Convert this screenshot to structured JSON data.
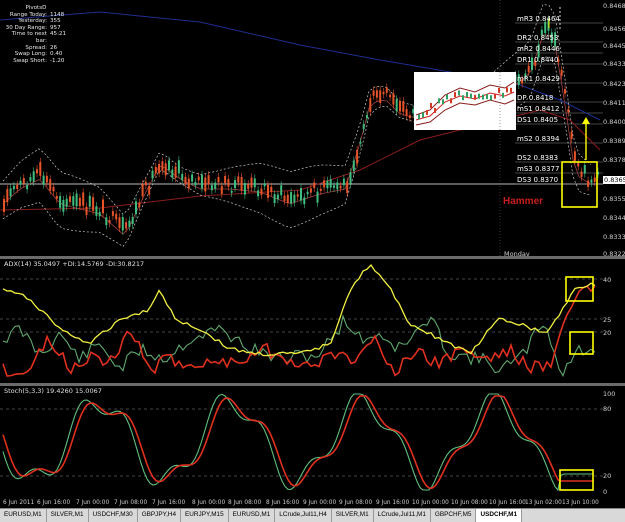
{
  "info_panel": {
    "title": "PivotsD",
    "rows": [
      {
        "label": "Range  Today:",
        "value": "1148"
      },
      {
        "label": "Yesterday:",
        "value": "355"
      },
      {
        "label": "30 Day Range:",
        "value": "957"
      },
      {
        "label": "Time to next bar:",
        "value": "45:21"
      },
      {
        "label": "Spread:",
        "value": "26"
      },
      {
        "label": "Swap  Long:",
        "value": "0.40"
      },
      {
        "label": "Swap  Short:",
        "value": "-1.20"
      }
    ]
  },
  "pivots": [
    {
      "label": "mR3",
      "value": "0.8464"
    },
    {
      "label": "DR2",
      "value": "0.8453"
    },
    {
      "label": "mR2",
      "value": "0.8446"
    },
    {
      "label": "DR1",
      "value": "0.8440"
    },
    {
      "label": "mR1",
      "value": "0.8429"
    },
    {
      "label": "DP",
      "value": "0.8418"
    },
    {
      "label": "mS1",
      "value": "0.8412"
    },
    {
      "label": "DS1",
      "value": "0.8405"
    },
    {
      "label": "mS2",
      "value": "0.8394"
    },
    {
      "label": "DS2",
      "value": "0.8383"
    },
    {
      "label": "mS3",
      "value": "0.8377"
    },
    {
      "label": "DS3",
      "value": "0.8370"
    }
  ],
  "price_axis": [
    "0.84680",
    "0.84565",
    "0.84450",
    "0.84335",
    "0.84230",
    "0.84115",
    "0.84000",
    "0.83895",
    "0.83780",
    "0.83665",
    "0.83550",
    "0.83445",
    "0.83335",
    "0.83225"
  ],
  "current_price": "0.83658",
  "annotations": {
    "hammer": "Hammer",
    "monday": "Monday"
  },
  "adx": {
    "title": "ADX(14) 35.0497 +DI:14.5769 -DI:30.8217",
    "axis": [
      "40",
      "25",
      "20"
    ],
    "colors": {
      "adx": "#f2f040",
      "plus_di": "#5fa86f",
      "minus_di": "#e0301e"
    }
  },
  "stoch": {
    "title": "Stoch(5,3,3) 19.4260 15.0067",
    "axis": [
      "100",
      "80",
      "20",
      "0"
    ],
    "colors": {
      "main": "#60c080",
      "signal": "#e0301e"
    }
  },
  "time_axis": [
    "6 Jun 2011",
    "6 Jun 16:00",
    "7 Jun 00:00",
    "7 Jun 08:00",
    "7 Jun 16:00",
    "8 Jun 00:00",
    "8 Jun 08:00",
    "8 Jun 16:00",
    "9 Jun 00:00",
    "9 Jun 08:00",
    "9 Jun 16:00",
    "10 Jun 00:00",
    "10 Jun 08:00",
    "10 Jun 16:00",
    "13 Jun 02:00",
    "13 Jun 10:00"
  ],
  "tabs": [
    "EURUSD,M1",
    "SILVER,M1",
    "USDCHF,M30",
    "GBPJPY,H4",
    "EURJPY,M15",
    "EURUSD,M1",
    "LCrude,Jul11,H4",
    "SILVER,M1",
    "LCrude,Jul11,M1",
    "GBPCHF,M5",
    "USDCHF,M1"
  ],
  "active_tab": "USDCHF,M1",
  "colors": {
    "bull": "#3fbf7f",
    "bear": "#e8542a",
    "highlight": "#ffff00",
    "background": "#000000"
  }
}
